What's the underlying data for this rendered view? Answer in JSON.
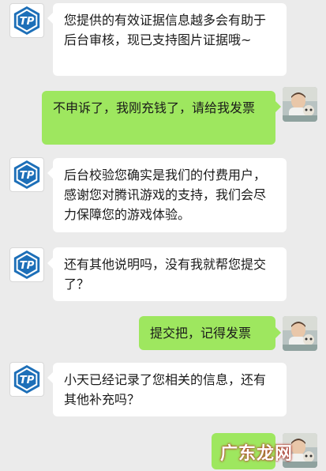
{
  "colors": {
    "background": "#ebebeb",
    "incoming_bubble": "#ffffff",
    "outgoing_bubble": "#9ee75f",
    "tp_logo_blue": "#1d6fb8",
    "watermark_red": "#c8321f"
  },
  "contacts": {
    "support_avatar_icon": "tp-logo-icon",
    "user_avatar_icon": "user-photo-avatar"
  },
  "messages": [
    {
      "side": "incoming",
      "text": "您提供的有效证据信息越多会有助于后台审核，现已支持图片证据哦~"
    },
    {
      "side": "outgoing",
      "text": "不申诉了，我刚充钱了，请给我发票"
    },
    {
      "side": "incoming",
      "text": "后台校验您确实是我们的付费用户，感谢您对腾讯游戏的支持，我们会尽力保障您的游戏体验。"
    },
    {
      "side": "incoming",
      "text": "还有其他说明吗，没有我就帮您提交了？"
    },
    {
      "side": "outgoing",
      "text": "提交把，记得发票"
    },
    {
      "side": "incoming",
      "text": "小天已经记录了您相关的信息，还有其他补充吗？"
    }
  ],
  "watermark": "广东龙网"
}
